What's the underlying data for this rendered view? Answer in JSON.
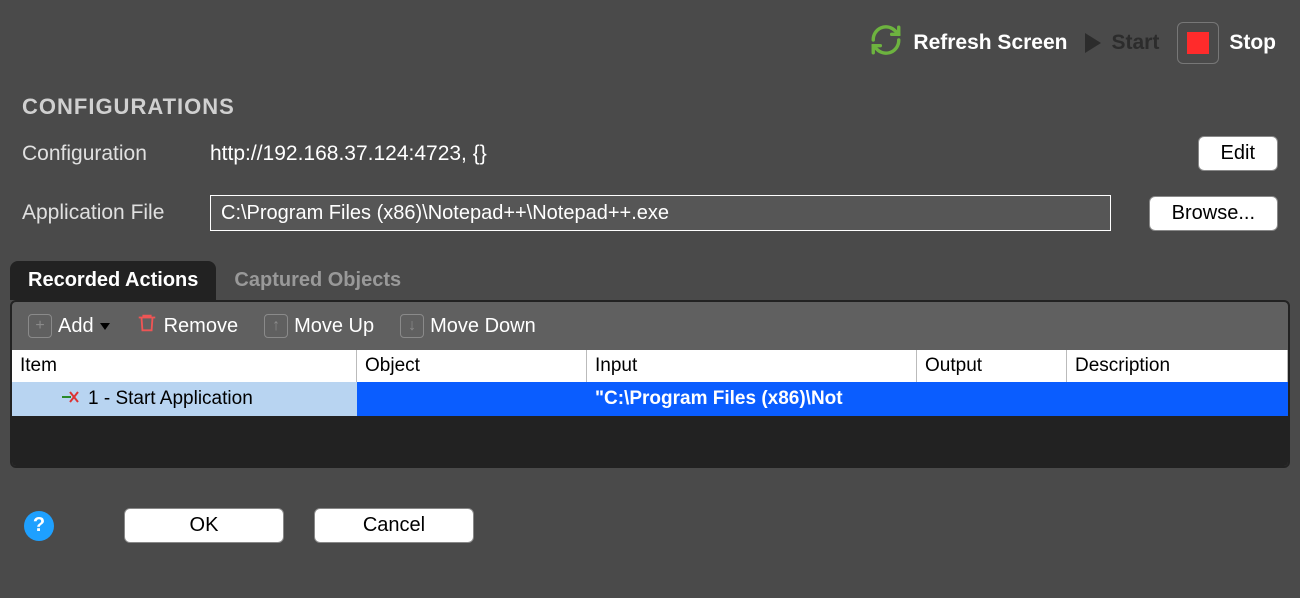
{
  "toolbar": {
    "refresh_label": "Refresh Screen",
    "start_label": "Start",
    "stop_label": "Stop"
  },
  "section_title": "CONFIGURATIONS",
  "form": {
    "config_label": "Configuration",
    "config_value": "http://192.168.37.124:4723, {}",
    "edit_label": "Edit",
    "appfile_label": "Application File",
    "appfile_value": "C:\\Program Files (x86)\\Notepad++\\Notepad++.exe",
    "browse_label": "Browse..."
  },
  "tabs": {
    "recorded": "Recorded Actions",
    "captured": "Captured Objects"
  },
  "panel_toolbar": {
    "add": "Add",
    "remove": "Remove",
    "move_up": "Move Up",
    "move_down": "Move Down"
  },
  "table": {
    "headers": {
      "item": "Item",
      "object": "Object",
      "input": "Input",
      "output": "Output",
      "description": "Description"
    },
    "rows": [
      {
        "item": "1 - Start Application",
        "object": "",
        "input": "\"C:\\Program Files (x86)\\Not",
        "output": "",
        "description": ""
      }
    ]
  },
  "bottom": {
    "help": "?",
    "ok": "OK",
    "cancel": "Cancel"
  }
}
